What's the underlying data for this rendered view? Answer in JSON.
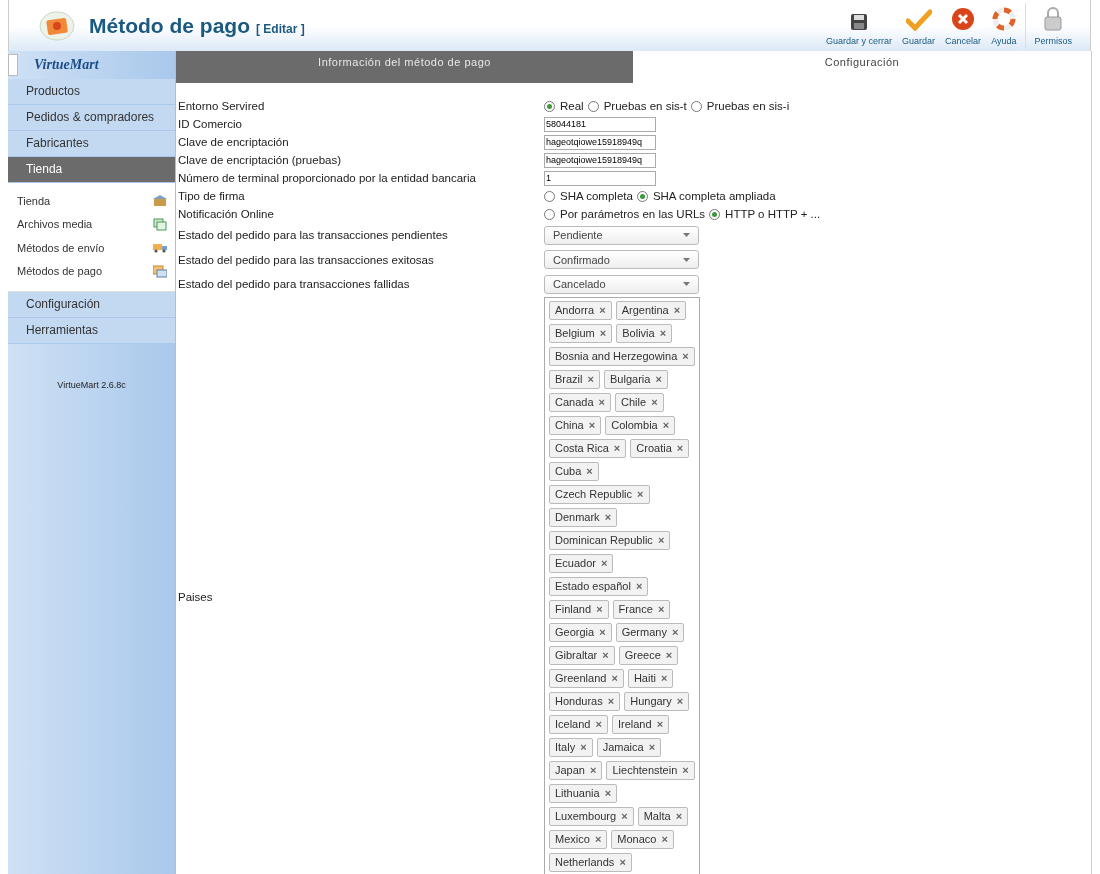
{
  "header": {
    "title": "Método de pago",
    "subtitle": "[ Editar ]"
  },
  "toolbar": [
    {
      "label": "Guardar y cerrar",
      "kind": "disk"
    },
    {
      "label": "Guardar",
      "kind": "check"
    },
    {
      "label": "Cancelar",
      "kind": "cancel"
    },
    {
      "label": "Ayuda",
      "kind": "help"
    },
    {
      "label": "Permisos",
      "kind": "lock"
    }
  ],
  "sidebar": {
    "logo": "VirtueMart",
    "menu": [
      {
        "label": "Productos",
        "selected": false
      },
      {
        "label": "Pedidos & compradores",
        "selected": false
      },
      {
        "label": "Fabricantes",
        "selected": false
      },
      {
        "label": "Tienda",
        "selected": true,
        "children": [
          {
            "label": "Tienda",
            "kind": "shop"
          },
          {
            "label": "Archivos media",
            "kind": "media"
          },
          {
            "label": "Métodos de envío",
            "kind": "truck"
          },
          {
            "label": "Métodos de pago",
            "kind": "payment"
          }
        ]
      },
      {
        "label": "Configuración",
        "selected": false
      },
      {
        "label": "Herramientas",
        "selected": false
      }
    ],
    "version": "VirtueMart 2.6.8c"
  },
  "tabs": [
    {
      "label": "Información del método de pago",
      "selected": false
    },
    {
      "label": "Configuración",
      "selected": true
    }
  ],
  "form": [
    {
      "kind": "radio",
      "label": "Entorno Servired",
      "options": [
        {
          "label": "Real",
          "selected": true
        },
        {
          "label": "Pruebas en sis-t",
          "selected": false
        },
        {
          "label": "Pruebas en sis-i",
          "selected": false
        }
      ]
    },
    {
      "kind": "text",
      "label": "ID Comercio",
      "value": "58044181"
    },
    {
      "kind": "text",
      "label": "Clave de encriptación",
      "value": "hageotqiowe15918949q"
    },
    {
      "kind": "text",
      "label": "Clave de encriptación (pruebas)",
      "value": "hageotqiowe15918949q"
    },
    {
      "kind": "text",
      "label": "Número de terminal proporcionado por la entidad bancaria",
      "value": "1"
    },
    {
      "kind": "radio",
      "label": "Tipo de firma",
      "options": [
        {
          "label": "SHA completa",
          "selected": false
        },
        {
          "label": "SHA completa ampliada",
          "selected": true
        }
      ]
    },
    {
      "kind": "radio",
      "label": "Notificación Online",
      "options": [
        {
          "label": "Por parámetros en las URLs",
          "selected": false
        },
        {
          "label": "HTTP o HTTP + ...",
          "selected": true
        }
      ]
    },
    {
      "kind": "select",
      "label": "Estado del pedido para las transacciones pendientes",
      "value": "Pendiente"
    },
    {
      "kind": "select",
      "label": "Estado del pedido para las transacciones exitosas",
      "value": "Confirmado"
    },
    {
      "kind": "select",
      "label": "Estado del pedido para transacciones fallidas",
      "value": "Cancelado"
    },
    {
      "kind": "tags",
      "label": "Paises",
      "tags": [
        "Andorra",
        "Argentina",
        "Belgium",
        "Bolivia",
        "Bosnia and Herzegowina",
        "Brazil",
        "Bulgaria",
        "Canada",
        "Chile",
        "China",
        "Colombia",
        "Costa Rica",
        "Croatia",
        "Cuba",
        "Czech Republic",
        "Denmark",
        "Dominican Republic",
        "Ecuador",
        "Estado español",
        "Finland",
        "France",
        "Georgia",
        "Germany",
        "Gibraltar",
        "Greece",
        "Greenland",
        "Haiti",
        "Honduras",
        "Hungary",
        "Iceland",
        "Ireland",
        "Italy",
        "Jamaica",
        "Japan",
        "Liechtenstein",
        "Lithuania",
        "Luxembourg",
        "Malta",
        "Mexico",
        "Monaco",
        "Netherlands"
      ],
      "remove": "×"
    }
  ]
}
